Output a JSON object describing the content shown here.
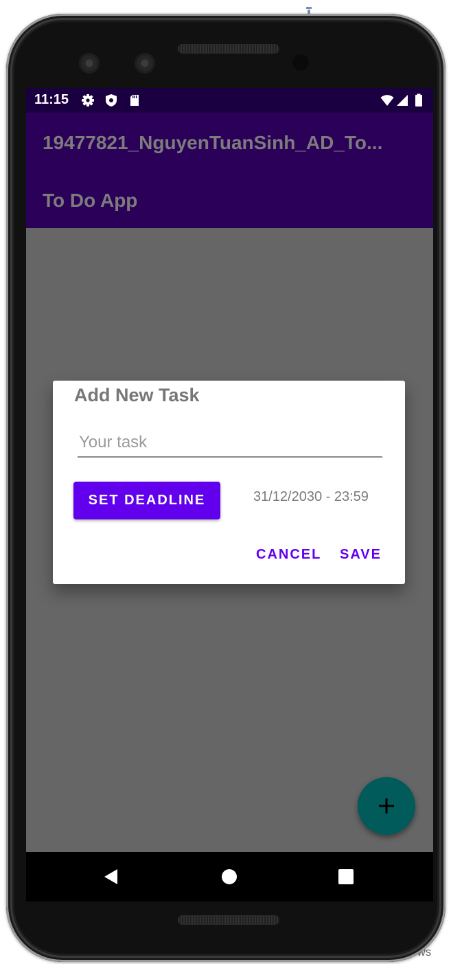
{
  "background": {
    "top_right_text": "matti",
    "bottom_right_text": "ews"
  },
  "status_bar": {
    "time": "11:15",
    "left_icons": [
      "gear-icon",
      "shield-icon",
      "sd-card-icon"
    ],
    "right_icons": [
      "wifi-icon",
      "signal-icon",
      "battery-icon"
    ]
  },
  "app_bar": {
    "title": "19477821_NguyenTuanSinh_AD_To...",
    "subtitle": "To Do App",
    "background_color": "#2b0059"
  },
  "dialog": {
    "title": "Add New Task",
    "task_input": {
      "value": "",
      "placeholder": "Your task"
    },
    "set_deadline_label": "SET DEADLINE",
    "deadline_value": "31/12/2030 - 23:59",
    "cancel_label": "CANCEL",
    "save_label": "SAVE",
    "accent_color": "#6200ee"
  },
  "fab": {
    "icon": "plus-icon",
    "color": "#015b5b"
  },
  "nav_bar": {
    "buttons": [
      "back-icon",
      "home-icon",
      "recents-icon"
    ]
  }
}
